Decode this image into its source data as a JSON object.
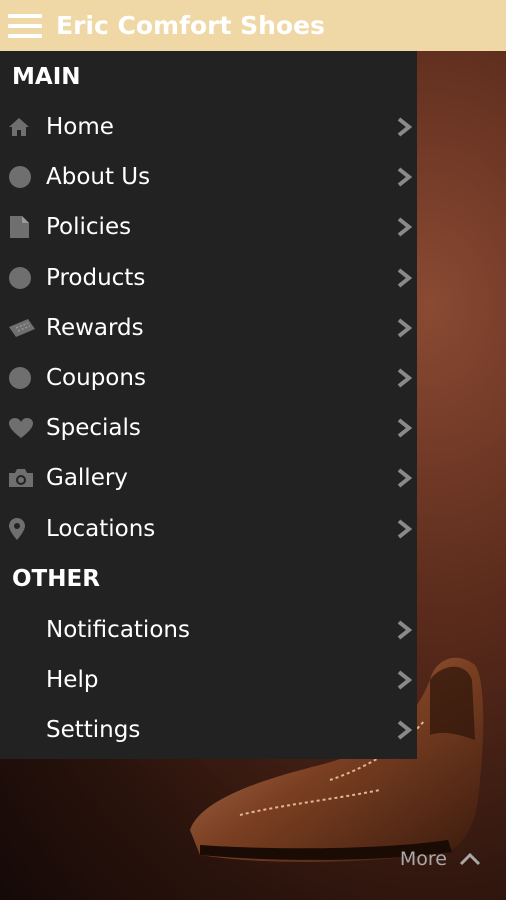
{
  "app": {
    "title": "Eric Comfort Shoes"
  },
  "menu": {
    "main_header": "MAIN",
    "main_items": [
      {
        "label": "Home",
        "icon": "home-icon"
      },
      {
        "label": "About Us",
        "icon": "circle-icon"
      },
      {
        "label": "Policies",
        "icon": "document-icon"
      },
      {
        "label": "Products",
        "icon": "circle-icon"
      },
      {
        "label": "Rewards",
        "icon": "ticket-icon"
      },
      {
        "label": "Coupons",
        "icon": "circle-icon"
      },
      {
        "label": "Specials",
        "icon": "heart-icon"
      },
      {
        "label": "Gallery",
        "icon": "camera-icon"
      },
      {
        "label": "Locations",
        "icon": "map-pin-icon"
      }
    ],
    "other_header": "OTHER",
    "other_items": [
      {
        "label": "Notifications"
      },
      {
        "label": "Help"
      },
      {
        "label": "Settings"
      }
    ]
  },
  "footer": {
    "more_label": "More"
  },
  "colors": {
    "topbar": "#efd8a6",
    "drawer": "#222222",
    "icon": "#6f6f6f"
  }
}
